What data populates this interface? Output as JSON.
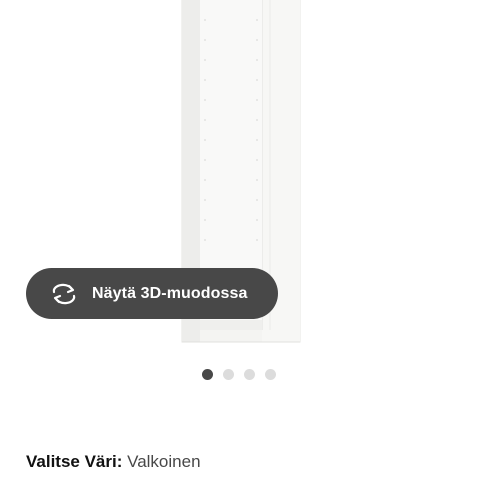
{
  "product_image": {
    "alt_name": "cabinet-frame-image"
  },
  "viewer": {
    "button_label": "Näytä 3D-muodossa",
    "icon": "rotate-3d-icon"
  },
  "carousel": {
    "total": 4,
    "active_index": 0
  },
  "color": {
    "label": "Valitse Väri:",
    "value": "Valkoinen"
  },
  "colors": {
    "button_bg": "#484848",
    "dot_active": "#484848",
    "dot_inactive": "#dcdcdc"
  }
}
